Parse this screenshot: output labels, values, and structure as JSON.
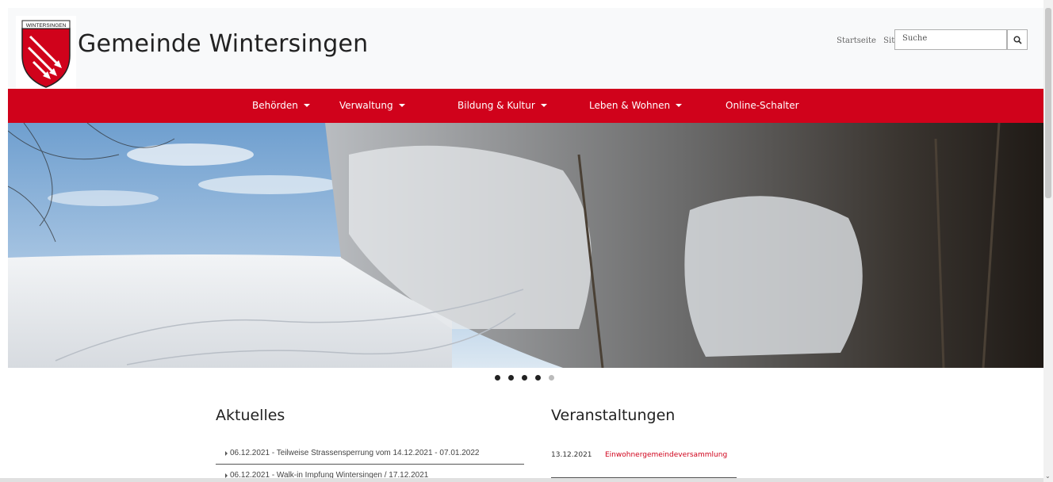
{
  "header": {
    "logo_text": "WINTERSINGEN",
    "site_title": "Gemeinde Wintersingen",
    "top_links": [
      "Startseite",
      "Sitemap"
    ],
    "search_placeholder": "Suche"
  },
  "nav": {
    "items": [
      {
        "label": "Behörden",
        "dropdown": true
      },
      {
        "label": "Verwaltung",
        "dropdown": true
      },
      {
        "label": "Bildung & Kultur",
        "dropdown": true
      },
      {
        "label": "Leben & Wohnen",
        "dropdown": true
      },
      {
        "label": "Online-Schalter",
        "dropdown": false
      }
    ]
  },
  "carousel": {
    "slide_count": 5,
    "active_index": 4
  },
  "news": {
    "title": "Aktuelles",
    "items": [
      "06.12.2021 - Teilweise Strassensperrung vom 14.12.2021 - 07.01.2022",
      "06.12.2021 - Walk-in Impfung Wintersingen / 17.12.2021"
    ]
  },
  "events": {
    "title": "Veranstaltungen",
    "items": [
      {
        "date": "13.12.2021",
        "name": "Einwohnergemeindeversammlung"
      }
    ]
  },
  "colors": {
    "brand_red": "#d0021b",
    "header_bg": "#f8f9fa"
  }
}
